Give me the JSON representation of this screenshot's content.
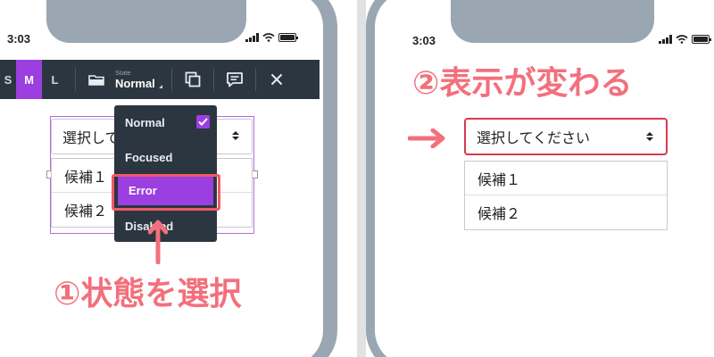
{
  "left": {
    "status": {
      "time": "3:03"
    },
    "toolbar": {
      "sizes": [
        "S",
        "M",
        "L"
      ],
      "active_size": "M",
      "state_label": "State",
      "state_value": "Normal",
      "icons": [
        "folder-icon",
        "copy-icon",
        "comment-icon",
        "close-icon"
      ]
    },
    "select": {
      "value": "選択して",
      "options": [
        "候補１",
        "候補２"
      ]
    },
    "menu": {
      "items": [
        "Normal",
        "Focused",
        "Error",
        "Disabled"
      ],
      "checked": "Normal",
      "selected": "Error"
    },
    "annotation": "①状態を選択"
  },
  "right": {
    "status": {
      "time": "3:03"
    },
    "annotation": "②表示が変わる",
    "select": {
      "value": "選択してください",
      "options": [
        "候補１",
        "候補２"
      ],
      "state_color": "#d9394f"
    }
  },
  "colors": {
    "accent": "#9b3fe0",
    "annotation": "#f2707c",
    "toolbar": "#2c3640",
    "phone_frame": "#9aa7b2",
    "error": "#d9394f"
  }
}
